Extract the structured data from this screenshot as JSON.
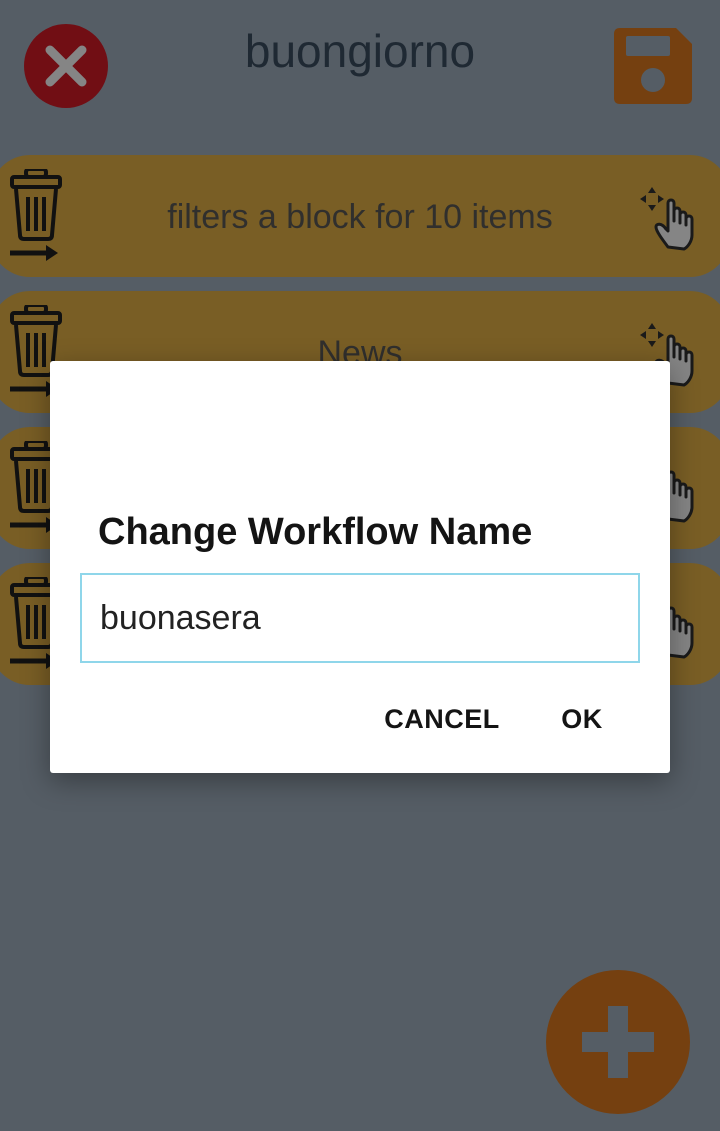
{
  "header": {
    "title": "buongiorno",
    "close_icon": "close-icon",
    "save_icon": "floppy-disk-icon",
    "close_color": "#d81b28",
    "save_color": "#e07b1f"
  },
  "workflows": [
    {
      "label": "filters a block for 10 items"
    },
    {
      "label": "News"
    },
    {
      "label": ""
    },
    {
      "label": ""
    }
  ],
  "item_icons": {
    "delete": "trash-arrow-icon",
    "drag": "drag-hand-icon"
  },
  "item_color": "#e8b447",
  "fab": {
    "icon": "plus-icon",
    "color": "#e07b1f"
  },
  "dialog": {
    "title": "Change Workflow Name",
    "input_value": "buonasera",
    "cancel_label": "CANCEL",
    "ok_label": "OK"
  }
}
